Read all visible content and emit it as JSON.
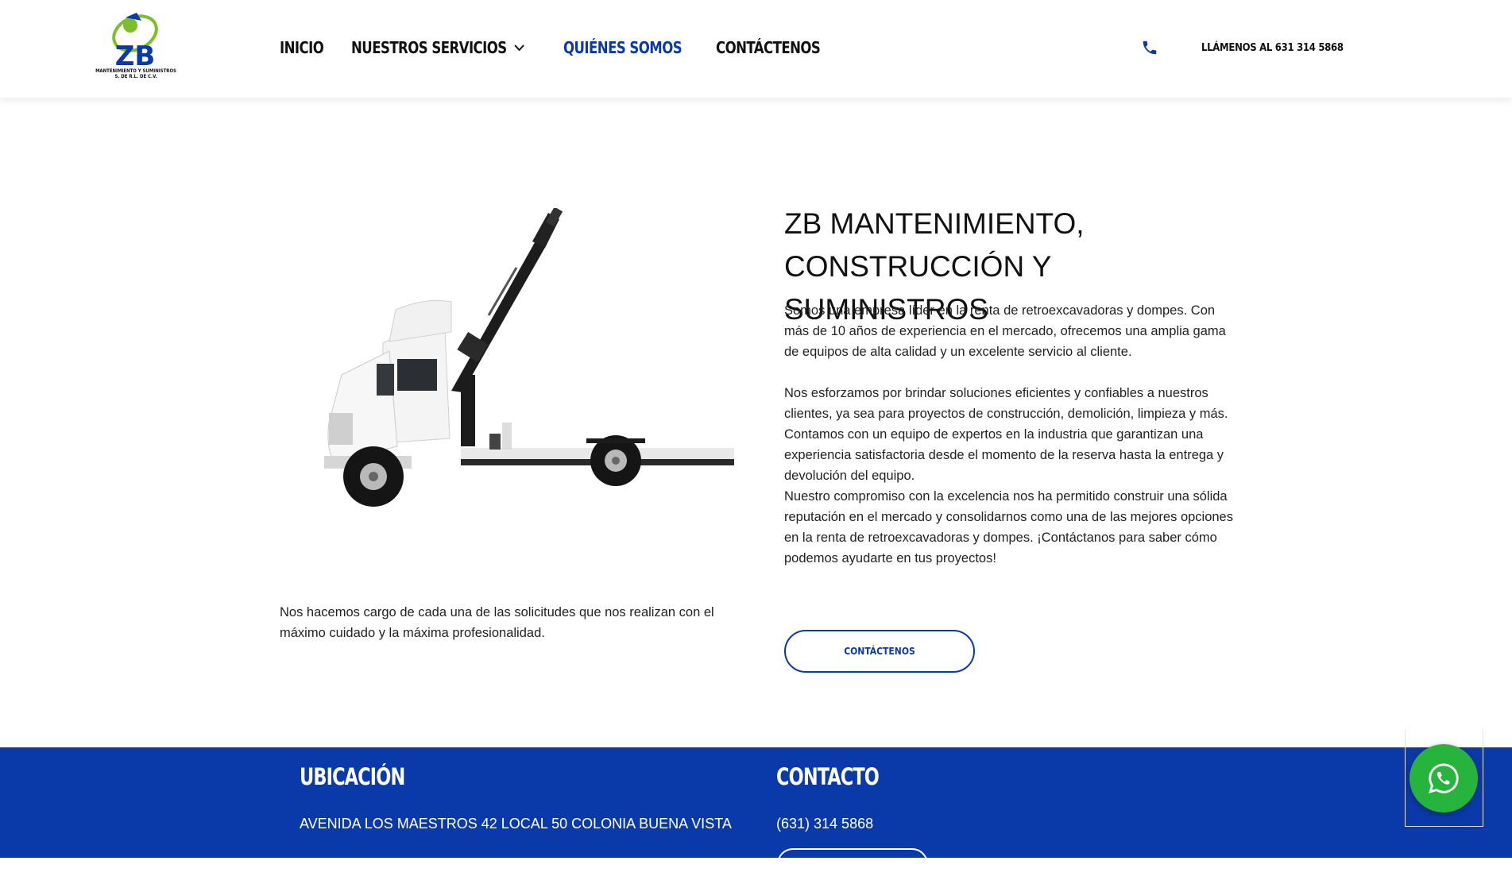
{
  "header": {
    "logo": {
      "mark": "ZB",
      "line1": "MANTENIMIENTO Y SUMINISTROS",
      "line2": "S. DE R.L. DE C.V."
    },
    "nav": [
      {
        "label": "INICIO"
      },
      {
        "label": "NUESTROS SERVICIOS",
        "has_dropdown": true
      },
      {
        "label": "QUIÉNES SOMOS",
        "active": true
      },
      {
        "label": "CONTÁCTENOS"
      }
    ],
    "phone_icon": "phone-icon",
    "phone_text": "LLÁMENOS AL 631 314 5868"
  },
  "main": {
    "image": "crane-truck-image",
    "left_text": "Nos hacemos cargo de cada una de las solicitudes que nos realizan con el máximo cuidado y la máxima profesionalidad.",
    "title_line1": "ZB MANTENIMIENTO,",
    "title_line2": "CONSTRUCCIÓN Y SUMINISTROS",
    "paragraphs": [
      "Somos una empresa líder en la renta de retroexcavadoras y dompes. Con más de 10 años de experiencia en el mercado, ofrecemos una amplia gama de equipos de alta calidad y un excelente servicio al cliente.",
      "Nos esforzamos por brindar soluciones eficientes y confiables a nuestros clientes, ya sea para proyectos de construcción, demolición, limpieza y más. Contamos con un equipo de expertos en la industria que garantizan una experiencia satisfactoria desde el momento de la reserva hasta la entrega y devolución del equipo.",
      "Nuestro compromiso con la excelencia nos ha permitido construir una sólida reputación en el mercado y consolidarnos como una de las mejores opciones en la renta de retroexcavadoras y dompes. ¡Contáctanos para saber cómo podemos ayudarte en tus proyectos!"
    ],
    "cta_label": "CONTÁCTENOS"
  },
  "footer": {
    "location_heading": "UBICACIÓN",
    "address": "AVENIDA LOS MAESTROS 42 LOCAL 50 COLONIA BUENA VISTA",
    "contact_heading": "CONTACTO",
    "phone": "(631) 314 5868"
  },
  "whatsapp_icon": "whatsapp-icon",
  "colors": {
    "brand_blue": "#0a3aa9",
    "whatsapp_green": "#27b43d"
  }
}
